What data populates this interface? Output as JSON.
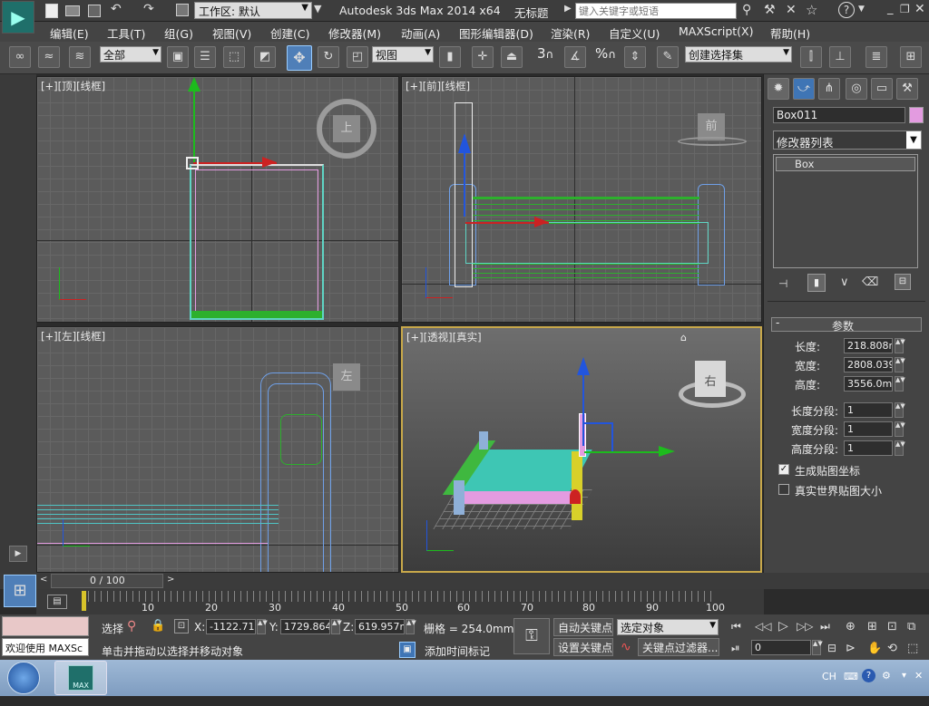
{
  "titlebar": {
    "workspace_label": "工作区: 默认",
    "app_title": "Autodesk 3ds Max  2014 x64",
    "doc_title": "无标题",
    "search_placeholder": "键入关键字或短语"
  },
  "menu": [
    "编辑(E)",
    "工具(T)",
    "组(G)",
    "视图(V)",
    "创建(C)",
    "修改器(M)",
    "动画(A)",
    "图形编辑器(D)",
    "渲染(R)",
    "自定义(U)",
    "MAXScript(X)",
    "帮助(H)"
  ],
  "toolbar": {
    "selection_filter": "全部",
    "ref_coord": "视图",
    "named_selection": "创建选择集",
    "snap_angle_num": "3",
    "percent_symbol": "%"
  },
  "viewports": {
    "top": {
      "label": "[+][顶][线框]",
      "cube": "上"
    },
    "front": {
      "label": "[+][前][线框]",
      "cube": "前"
    },
    "left": {
      "label": "[+][左][线框]",
      "cube": "左"
    },
    "perspective": {
      "label": "[+][透视][真实]",
      "cube": "右"
    }
  },
  "command_panel": {
    "object_name": "Box011",
    "modifier_list": "修改器列表",
    "stack_item": "Box",
    "rollout_title": "参数",
    "params": [
      {
        "label": "长度:",
        "value": "218.808m"
      },
      {
        "label": "宽度:",
        "value": "2808.039("
      },
      {
        "label": "高度:",
        "value": "3556.0mm"
      },
      {
        "label": "长度分段:",
        "value": "1"
      },
      {
        "label": "宽度分段:",
        "value": "1"
      },
      {
        "label": "高度分段:",
        "value": "1"
      }
    ],
    "checkboxes": [
      {
        "label": "生成贴图坐标",
        "checked": true
      },
      {
        "label": "真实世界贴图大小",
        "checked": false
      }
    ]
  },
  "timeline": {
    "frame_display": "0 / 100",
    "ticks": [
      "10",
      "20",
      "30",
      "40",
      "50",
      "60",
      "70",
      "80",
      "90",
      "100"
    ]
  },
  "status": {
    "welcome": "欢迎使用 MAXSc",
    "select_label": "选择",
    "x_label": "X:",
    "x_value": "-1122.713",
    "y_label": "Y:",
    "y_value": "1729.864m",
    "z_label": "Z:",
    "z_value": "619.957mr",
    "grid": "栅格 = 254.0mm",
    "prompt": "单击并拖动以选择并移动对象",
    "add_time_tag": "添加时间标记",
    "auto_key": "自动关键点",
    "set_key": "设置关键点",
    "key_mode": "选定对象",
    "key_filters": "关键点过滤器...",
    "current_frame": "0"
  },
  "taskbar": {
    "app_label": "MAX",
    "lang": "CH"
  },
  "colors": {
    "object_color": "#e39be0",
    "accent": "#c8a84a"
  }
}
